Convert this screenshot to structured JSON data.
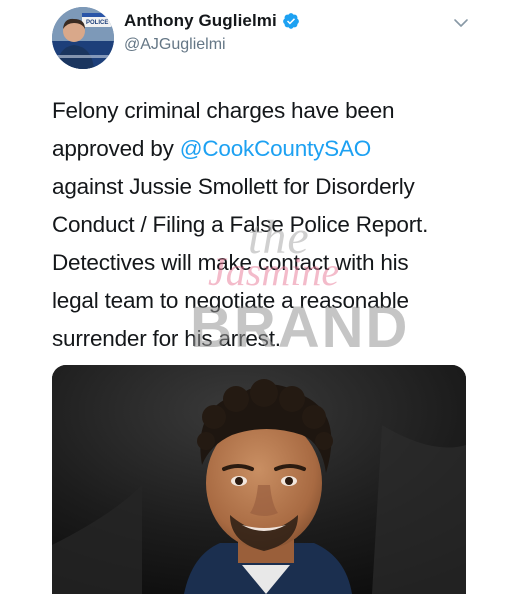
{
  "author": {
    "display_name": "Anthony Guglielmi",
    "handle": "@AJGuglielmi",
    "verified": true,
    "avatar_badge_text": "POLICE"
  },
  "tweet": {
    "lines": [
      {
        "before": "Felony criminal charges have been",
        "mention": "",
        "after": ""
      },
      {
        "before": "approved by ",
        "mention": "@CookCountySAO",
        "after": ""
      },
      {
        "before": "against Jussie Smollett for Disorderly",
        "mention": "",
        "after": ""
      },
      {
        "before": "Conduct / Filing a False Police Report.",
        "mention": "",
        "after": ""
      },
      {
        "before": "Detectives will make contact with his",
        "mention": "",
        "after": ""
      },
      {
        "before": "legal team to negotiate a reasonable",
        "mention": "",
        "after": ""
      },
      {
        "before": "surrender for his arrest.",
        "mention": "",
        "after": ""
      }
    ]
  },
  "watermark": {
    "the": "the",
    "jasmine": "Jasmine",
    "brand": "BRAND"
  },
  "icons": {
    "verified": "verified-badge-icon",
    "menu": "chevron-down-icon"
  },
  "colors": {
    "mention": "#1da1f2",
    "verified": "#1da1f2",
    "text": "#14171a",
    "muted": "#657786"
  }
}
